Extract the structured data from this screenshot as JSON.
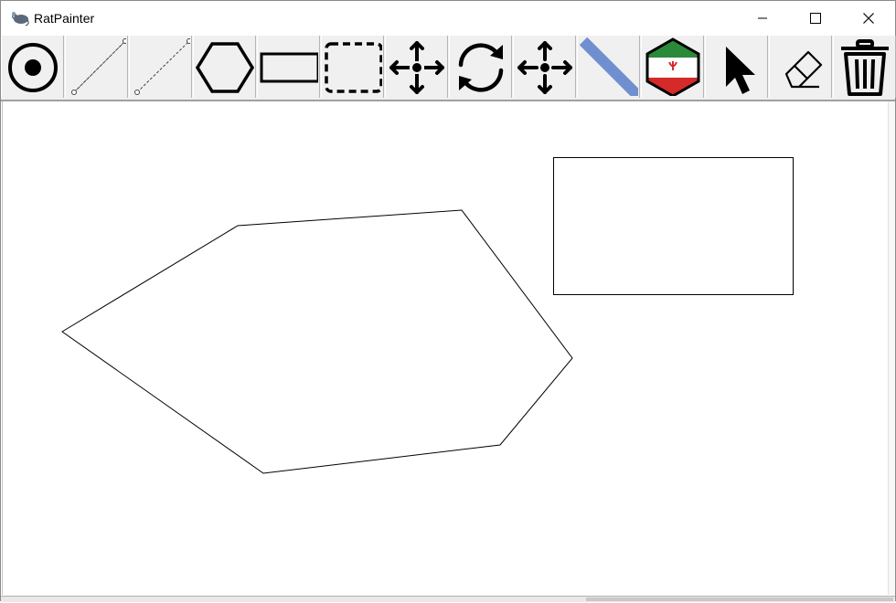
{
  "window": {
    "title": "RatPainter",
    "controls": [
      "minimize",
      "maximize",
      "close"
    ]
  },
  "toolbar": {
    "tools": [
      {
        "name": "point-tool",
        "icon": "target-dot-icon"
      },
      {
        "name": "line-tool",
        "icon": "line-segment-icon"
      },
      {
        "name": "ray-tool",
        "icon": "line-segment-icon"
      },
      {
        "name": "polygon-tool",
        "icon": "hexagon-icon"
      },
      {
        "name": "rectangle-tool",
        "icon": "rectangle-icon"
      },
      {
        "name": "selection-tool",
        "icon": "dashed-rectangle-icon"
      },
      {
        "name": "move-tool",
        "icon": "move-arrows-icon"
      },
      {
        "name": "rotate-tool",
        "icon": "rotate-icon"
      },
      {
        "name": "pan-tool",
        "icon": "move-arrows-icon"
      },
      {
        "name": "thickness-tool",
        "icon": "thick-line-icon"
      },
      {
        "name": "color-fill-tool",
        "icon": "iran-flag-hexagon-icon"
      },
      {
        "name": "select-pointer-tool",
        "icon": "cursor-arrow-icon"
      },
      {
        "name": "eraser-tool",
        "icon": "eraser-icon"
      },
      {
        "name": "delete-tool",
        "icon": "trash-icon"
      }
    ]
  },
  "colors": {
    "toolbar_bg": "#f0f0f0",
    "canvas_bg": "#ffffff",
    "thickness_blue": "#6f8fd0",
    "flag_green": "#2a8a3a",
    "flag_red": "#d42a2a"
  },
  "canvas": {
    "shapes": [
      {
        "type": "polygon",
        "name": "drawn-polygon"
      },
      {
        "type": "rectangle",
        "name": "drawn-rectangle"
      }
    ]
  }
}
